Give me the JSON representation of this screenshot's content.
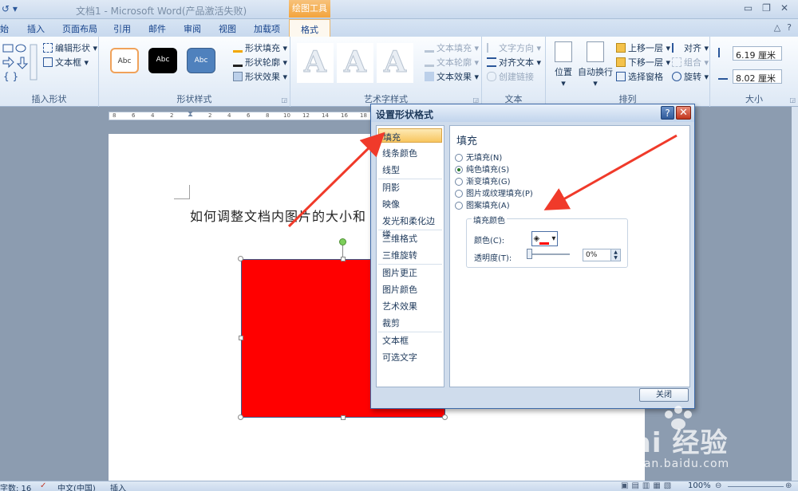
{
  "window": {
    "title": "文档1 - Microsoft Word(产品激活失败)",
    "context_tab": "绘图工具",
    "minimize": "▭",
    "restore": "❐",
    "close": "✕"
  },
  "tabs": [
    "始",
    "插入",
    "页面布局",
    "引用",
    "邮件",
    "审阅",
    "视图",
    "加载项",
    "格式"
  ],
  "active_tab": "格式",
  "ribbon": {
    "insert_shapes": {
      "label": "插入形状",
      "edit_shape": "编辑形状",
      "text_box": "文本框"
    },
    "shape_styles": {
      "label": "形状样式",
      "styles": [
        "Abc",
        "Abc",
        "Abc"
      ],
      "fill": "形状填充",
      "outline": "形状轮廓",
      "effects": "形状效果"
    },
    "wordart": {
      "label": "艺术字样式",
      "glyph": "A",
      "text_fill": "文本填充",
      "text_outline": "文本轮廓",
      "text_effects": "文本效果"
    },
    "text": {
      "label": "文本",
      "direction": "文字方向",
      "align": "对齐文本",
      "link": "创建链接"
    },
    "arrange": {
      "label": "排列",
      "position": "位置",
      "wrap": "自动换行",
      "bring_forward": "上移一层",
      "send_backward": "下移一层",
      "selection_pane": "选择窗格",
      "align": "对齐",
      "group": "组合",
      "rotate": "旋转"
    },
    "size": {
      "label": "大小",
      "height": "6.19 厘米",
      "width": "8.02 厘米"
    }
  },
  "ruler": [
    "8",
    "6",
    "4",
    "2",
    "2",
    "4",
    "6",
    "8",
    "10",
    "12",
    "14",
    "16",
    "18"
  ],
  "document": {
    "text": "如何调整文档内图片的大小和"
  },
  "status": {
    "words": "字数: 16",
    "language": "中文(中国)",
    "mode": "插入",
    "zoom": "100%"
  },
  "dialog": {
    "title": "设置形状格式",
    "help": "?",
    "close": "✕",
    "nav": [
      "填充",
      "线条颜色",
      "线型",
      "阴影",
      "映像",
      "发光和柔化边缘",
      "三维格式",
      "三维旋转",
      "图片更正",
      "图片颜色",
      "艺术效果",
      "裁剪",
      "文本框",
      "可选文字"
    ],
    "active_nav": "填充",
    "panel_title": "填充",
    "options": [
      "无填充(N)",
      "纯色填充(S)",
      "渐变填充(G)",
      "图片或纹理填充(P)",
      "图案填充(A)"
    ],
    "selected_option": "纯色填充(S)",
    "fill_color_group": "填充颜色",
    "color_label": "颜色(C):",
    "transparency_label": "透明度(T):",
    "transparency_value": "0%",
    "close_button": "关闭"
  },
  "colors": {
    "shape_fill": "#ff0000",
    "annotation_arrow": "#f03a2a"
  },
  "watermark": {
    "brand": "Bai  经验",
    "url": "jingyan.baidu.com"
  }
}
